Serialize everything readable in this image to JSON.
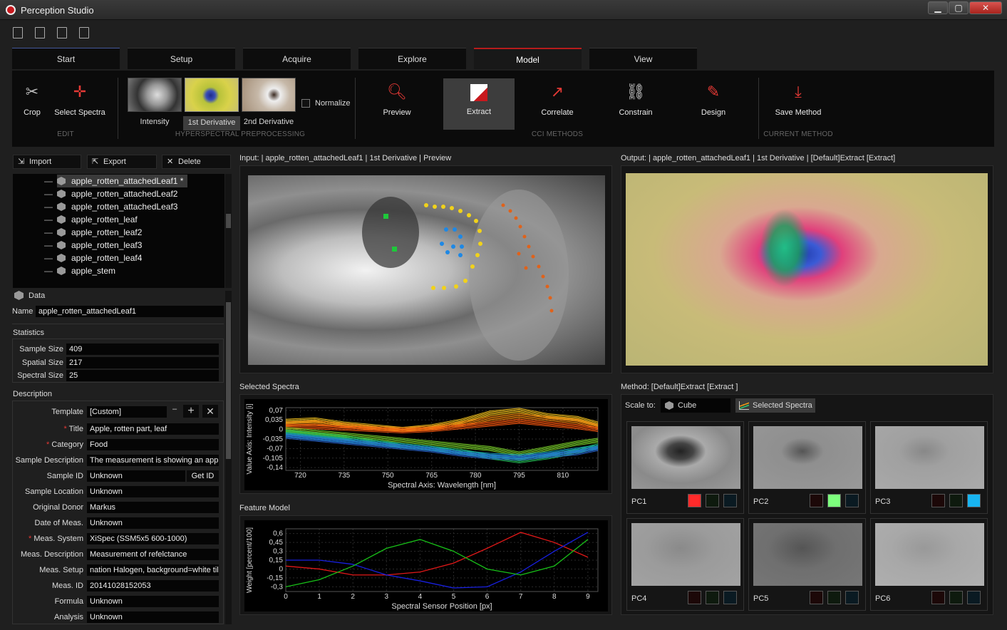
{
  "window": {
    "title": "Perception Studio",
    "minimize": "▁",
    "maximize": "▢",
    "close": "✕"
  },
  "tabs": [
    {
      "label": "Start"
    },
    {
      "label": "Setup"
    },
    {
      "label": "Acquire"
    },
    {
      "label": "Explore"
    },
    {
      "label": "Model"
    },
    {
      "label": "View"
    }
  ],
  "ribbon": {
    "crop": "Crop",
    "select_spectra": "Select Spectra",
    "group_edit": "EDIT",
    "intensity": "Intensity",
    "first_derivative": "1st Derivative",
    "second_derivative": "2nd Derivative",
    "normalize": "Normalize",
    "group_preprocessing": "HYPERSPECTRAL PREPROCESSING",
    "preview": "Preview",
    "extract": "Extract",
    "correlate": "Correlate",
    "constrain": "Constrain",
    "design": "Design",
    "group_cci": "CCI METHODS",
    "save_method": "Save Method",
    "group_current": "CURRENT METHOD"
  },
  "left_panel": {
    "import": "Import",
    "export": "Export",
    "delete": "Delete",
    "tree": [
      "apple_rotten_attachedLeaf1 *",
      "apple_rotten_attachedLeaf2",
      "apple_rotten_attachedLeaf3",
      "apple_rotten_leaf",
      "apple_rotten_leaf2",
      "apple_rotten_leaf3",
      "apple_rotten_leaf4",
      "apple_stem"
    ],
    "data_title": "Data",
    "name_label": "Name",
    "name_value": "apple_rotten_attachedLeaf1",
    "statistics_title": "Statistics",
    "sample_size_label": "Sample Size",
    "sample_size": "409",
    "spatial_size_label": "Spatial Size",
    "spatial_size": "217",
    "spectral_size_label": "Spectral Size",
    "spectral_size": "25",
    "description_title": "Description",
    "template_label": "Template",
    "template_value": "[Custom]",
    "get_id": "Get ID",
    "fields": [
      {
        "label": "Title",
        "value": "Apple, rotten part, leaf",
        "required": "*"
      },
      {
        "label": "Category",
        "value": "Food",
        "required": "*"
      },
      {
        "label": "Sample Description",
        "value": "The measurement is showing an apple",
        "required": ""
      },
      {
        "label": "Sample ID",
        "value": "Unknown",
        "required": ""
      },
      {
        "label": "Sample Location",
        "value": "Unknown",
        "required": ""
      },
      {
        "label": "Original Donor",
        "value": "Markus",
        "required": ""
      },
      {
        "label": "Date of Meas.",
        "value": "Unknown",
        "required": ""
      },
      {
        "label": "Meas. System",
        "value": "XiSpec (SSM5x5 600-1000)",
        "required": "*"
      },
      {
        "label": "Meas. Description",
        "value": "Measurement of refelctance",
        "required": ""
      },
      {
        "label": "Meas. Setup",
        "value": "nation Halogen, background=white tile",
        "required": ""
      },
      {
        "label": "Meas. ID",
        "value": "20141028152053",
        "required": ""
      },
      {
        "label": "Formula",
        "value": "Unknown",
        "required": ""
      },
      {
        "label": "Analysis",
        "value": "Unknown",
        "required": ""
      }
    ]
  },
  "views": {
    "input_title": "Input: | apple_rotten_attachedLeaf1 | 1st Derivative | Preview",
    "output_title": "Output: | apple_rotten_attachedLeaf1 | 1st Derivative | [Default]Extract [Extract]",
    "selected_spectra_title": "Selected Spectra",
    "feature_model_title": "Feature Model",
    "method_title": "Method: [Default]Extract [Extract ]",
    "scale_to": "Scale to:",
    "cube": "Cube",
    "selected_spectra_btn": "Selected Spectra",
    "pcs": [
      "PC1",
      "PC2",
      "PC3",
      "PC4",
      "PC5",
      "PC6"
    ]
  },
  "colors": {
    "accent": "#b71c1c",
    "pc_red": "#ff2a2a",
    "pc_green": "#7dff7d",
    "pc_blue": "#18b4f0"
  },
  "chart_data": [
    {
      "type": "line",
      "title": "Selected Spectra",
      "xlabel": "Spectral Axis: Wavelength [nm]",
      "ylabel": "Value Axis: Intensity [i]",
      "x_ticks": [
        720,
        735,
        750,
        765,
        780,
        795,
        810
      ],
      "y_ticks": [
        "0,07",
        "0,035",
        "0",
        "-0,035",
        "-0,07",
        "-0,105",
        "-0,14"
      ],
      "xlim": [
        715,
        822
      ],
      "ylim": [
        -0.15,
        0.08
      ],
      "x": [
        715,
        725,
        735,
        745,
        755,
        765,
        775,
        785,
        795,
        805,
        815,
        822
      ],
      "series": [
        {
          "color": "#f7c41e",
          "values": [
            0.03,
            0.035,
            0.02,
            0.01,
            0.0,
            0.01,
            0.03,
            0.06,
            0.07,
            0.05,
            0.04,
            0.02
          ]
        },
        {
          "color": "#f58a12",
          "values": [
            0.02,
            0.025,
            0.015,
            0.005,
            0.0,
            0.005,
            0.02,
            0.04,
            0.05,
            0.04,
            0.03,
            0.01
          ]
        },
        {
          "color": "#ff5a10",
          "values": [
            0.01,
            0.01,
            0.005,
            0.0,
            -0.005,
            0.0,
            0.01,
            0.02,
            0.03,
            0.02,
            0.01,
            0.0
          ]
        },
        {
          "color": "#7ad12a",
          "values": [
            0.0,
            -0.01,
            -0.02,
            -0.03,
            -0.04,
            -0.05,
            -0.06,
            -0.07,
            -0.09,
            -0.07,
            -0.05,
            -0.04
          ]
        },
        {
          "color": "#26c45b",
          "values": [
            -0.01,
            -0.02,
            -0.03,
            -0.045,
            -0.06,
            -0.07,
            -0.08,
            -0.1,
            -0.115,
            -0.1,
            -0.08,
            -0.06
          ]
        },
        {
          "color": "#18a9c9",
          "values": [
            -0.02,
            -0.03,
            -0.04,
            -0.05,
            -0.06,
            -0.07,
            -0.085,
            -0.095,
            -0.1,
            -0.09,
            -0.075,
            -0.065
          ]
        },
        {
          "color": "#2a6ad8",
          "values": [
            -0.025,
            -0.035,
            -0.045,
            -0.055,
            -0.065,
            -0.075,
            -0.09,
            -0.1,
            -0.105,
            -0.095,
            -0.085,
            -0.07
          ]
        }
      ]
    },
    {
      "type": "line",
      "title": "Feature Model",
      "xlabel": "Spectral Sensor Position [px]",
      "ylabel": "Weight [percent/100]",
      "x_ticks": [
        0,
        2,
        4,
        6,
        8
      ],
      "x_ticks_odd": [
        1,
        3,
        5,
        7,
        9
      ],
      "y_ticks": [
        "0,6",
        "0,45",
        "0,3",
        "0,15",
        "0",
        "-0,15",
        "-0,3"
      ],
      "xlim": [
        0,
        9.3
      ],
      "ylim": [
        -0.38,
        0.68
      ],
      "x": [
        0,
        1,
        2,
        3,
        4,
        5,
        6,
        7,
        8,
        9
      ],
      "series": [
        {
          "color": "#e01818",
          "values": [
            0.05,
            0.0,
            -0.1,
            -0.1,
            -0.05,
            0.1,
            0.35,
            0.62,
            0.45,
            0.2
          ]
        },
        {
          "color": "#1820e0",
          "values": [
            0.15,
            0.15,
            0.08,
            -0.1,
            -0.2,
            -0.32,
            -0.3,
            -0.05,
            0.3,
            0.62
          ]
        },
        {
          "color": "#18c018",
          "values": [
            -0.3,
            -0.18,
            0.05,
            0.35,
            0.5,
            0.3,
            0.0,
            -0.1,
            0.05,
            0.5
          ]
        }
      ]
    }
  ]
}
